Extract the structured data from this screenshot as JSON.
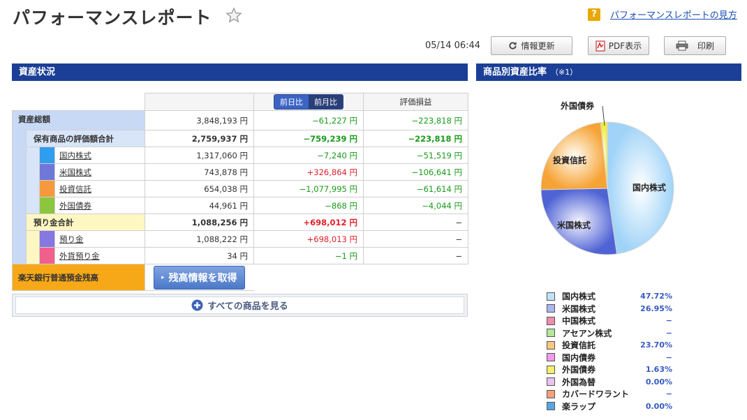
{
  "header": {
    "title": "パフォーマンスレポート",
    "help_link": "パフォーマンスレポートの見方",
    "help_icon": "?"
  },
  "toolbar": {
    "timestamp": "05/14 06:44",
    "refresh_label": "情報更新",
    "pdf_label": "PDF表示",
    "print_label": "印刷"
  },
  "assets": {
    "section_title": "資産状況",
    "tab_day": "前日比",
    "tab_month": "前月比",
    "col_pl": "評価損益",
    "total": {
      "label": "資産総額",
      "value": "3,848,193 円",
      "change": "−61,227 円",
      "pl": "−223,818 円"
    },
    "holdings": {
      "label": "保有商品の評価額合計",
      "value": "2,759,937 円",
      "change": "−759,239 円",
      "pl": "−223,818 円"
    },
    "items": [
      {
        "label": "国内株式",
        "value": "1,317,060 円",
        "change": "−7,240 円",
        "change_sign": "neg",
        "pl": "−51,519 円",
        "color": "#2f9df0"
      },
      {
        "label": "米国株式",
        "value": "743,878 円",
        "change": "+326,864 円",
        "change_sign": "pos",
        "pl": "−106,641 円",
        "color": "#6f78d8"
      },
      {
        "label": "投資信託",
        "value": "654,038 円",
        "change": "−1,077,995 円",
        "change_sign": "neg",
        "pl": "−61,614 円",
        "color": "#f49a3c"
      },
      {
        "label": "外国債券",
        "value": "44,961 円",
        "change": "−868 円",
        "change_sign": "neg",
        "pl": "−4,044 円",
        "color": "#8cc63f"
      }
    ],
    "deposits": {
      "label": "預り金合計",
      "value": "1,088,256 円",
      "change": "+698,012 円",
      "pl": "−"
    },
    "deposit_items": [
      {
        "label": "預り金",
        "value": "1,088,222 円",
        "change": "+698,013 円",
        "change_sign": "pos",
        "pl": "−",
        "color": "#8578e0"
      },
      {
        "label": "外貨預り金",
        "value": "34 円",
        "change": "−1 円",
        "change_sign": "neg",
        "pl": "−",
        "color": "#f0608c"
      }
    ],
    "bank": {
      "label": "楽天銀行普通預金残高",
      "button": "残高情報を取得"
    },
    "see_all": "すべての商品を見る"
  },
  "allocation": {
    "section_title": "商品別資産比率",
    "section_note": "（※1）",
    "pie_labels": {
      "domestic": "国内株式",
      "us": "米国株式",
      "fund": "投資信託",
      "fbond": "外国債券"
    },
    "legend": [
      {
        "name": "国内株式",
        "pct": "47.72%",
        "color": "#bfe3fb"
      },
      {
        "name": "米国株式",
        "pct": "26.95%",
        "color": "#aab6ee"
      },
      {
        "name": "中国株式",
        "pct": "−",
        "color": "#f08cae"
      },
      {
        "name": "アセアン株式",
        "pct": "−",
        "color": "#b6e59a"
      },
      {
        "name": "投資信託",
        "pct": "23.70%",
        "color": "#f8c780"
      },
      {
        "name": "国内債券",
        "pct": "−",
        "color": "#f49ae8"
      },
      {
        "name": "外国債券",
        "pct": "1.63%",
        "color": "#f4ef6e"
      },
      {
        "name": "外国為替",
        "pct": "0.00%",
        "color": "#e9c3ef"
      },
      {
        "name": "カバードワラント",
        "pct": "−",
        "color": "#f4a07c"
      },
      {
        "name": "楽ラップ",
        "pct": "0.00%",
        "color": "#5aa6e4"
      }
    ]
  }
}
